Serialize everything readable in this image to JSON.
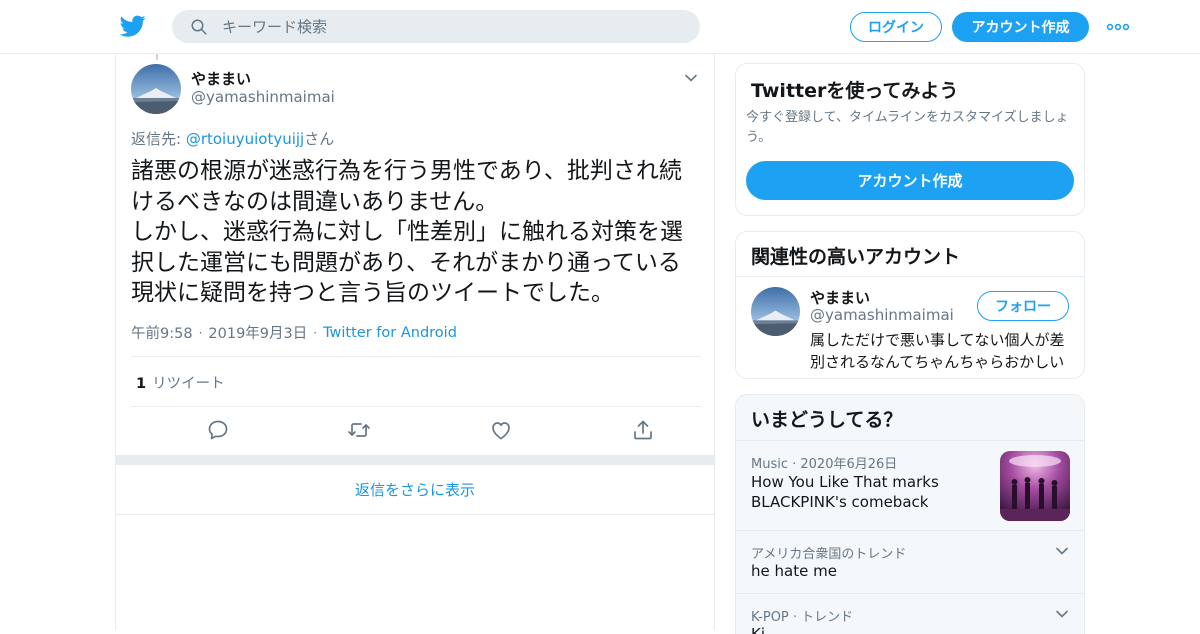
{
  "header": {
    "search_placeholder": "キーワード検索",
    "login_label": "ログイン",
    "signup_label": "アカウント作成",
    "brand_color": "#1da1f2"
  },
  "tweet": {
    "author_name": "やままい",
    "author_handle": "@yamashinmaimai",
    "reply_prefix": "返信先: ",
    "reply_handle": "@rtoiuyuiotyuijj",
    "reply_suffix": "さん",
    "text": "諸悪の根源が迷惑行為を行う男性であり、批判され続けるべきなのは間違いありません。\nしかし、迷惑行為に対し「性差別」に触れる対策を選択した運営にも問題があり、それがまかり通っている現状に疑問を持つと言う旨のツイートでした。",
    "time": "午前9:58",
    "date": "2019年9月3日",
    "client": "Twitter for Android",
    "retweet_count": "1",
    "retweet_label": "リツイート",
    "more_replies_label": "返信をさらに表示"
  },
  "sidebar": {
    "signup_card": {
      "title": "Twitterを使ってみよう",
      "description": "今すぐ登録して、タイムラインをカスタマイズしましょう。",
      "button_label": "アカウント作成"
    },
    "related_card": {
      "title": "関連性の高いアカウント",
      "account_name": "やままい",
      "account_handle": "@yamashinmaimai",
      "follow_label": "フォロー",
      "bio": "属しただけで悪い事してない個人が差別されるなんてちゃんちゃらおかしい"
    },
    "trends_card": {
      "title": "いまどうしてる？",
      "items": [
        {
          "context": "Music · 2020年6月26日",
          "title": "How You Like That marks BLACKPINK's comeback"
        },
        {
          "context": "アメリカ合衆国のトレンド",
          "title": "he hate me"
        },
        {
          "context": "K-POP · トレンド",
          "title": "Ki..."
        }
      ]
    }
  }
}
